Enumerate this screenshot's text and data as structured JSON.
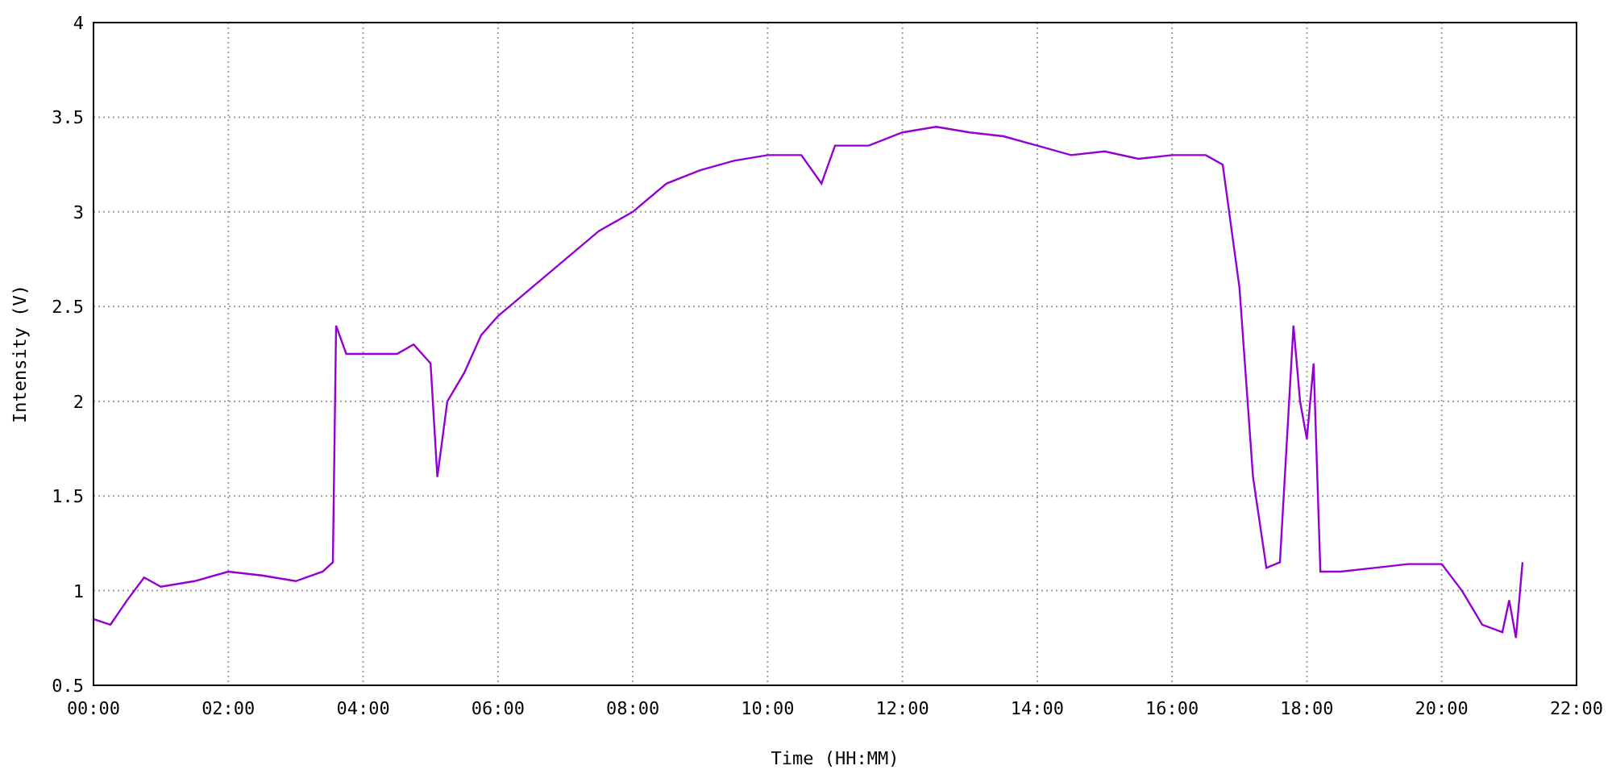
{
  "chart_data": {
    "type": "line",
    "grid": true,
    "xlabel": "Time (HH:MM)",
    "ylabel": "Intensity (V)",
    "x": [
      0,
      0.25,
      0.5,
      0.75,
      1.0,
      1.5,
      2.0,
      2.5,
      3.0,
      3.4,
      3.55,
      3.6,
      3.75,
      4.0,
      4.5,
      4.75,
      5.0,
      5.1,
      5.25,
      5.5,
      5.75,
      6.0,
      6.5,
      7.0,
      7.5,
      8.0,
      8.5,
      9.0,
      9.5,
      10.0,
      10.5,
      10.8,
      11.0,
      11.5,
      12.0,
      12.5,
      13.0,
      13.5,
      14.0,
      14.5,
      15.0,
      15.5,
      16.0,
      16.5,
      16.75,
      17.0,
      17.2,
      17.4,
      17.6,
      17.8,
      17.9,
      18.0,
      18.1,
      18.2,
      18.5,
      19.0,
      19.5,
      20.0,
      20.3,
      20.6,
      20.9,
      21.0,
      21.1,
      21.2
    ],
    "series": [
      {
        "color": "#9400d3",
        "values": [
          0.85,
          0.82,
          0.95,
          1.07,
          1.02,
          1.05,
          1.1,
          1.08,
          1.05,
          1.1,
          1.15,
          2.4,
          2.25,
          2.25,
          2.25,
          2.3,
          2.2,
          1.6,
          2.0,
          2.15,
          2.35,
          2.45,
          2.6,
          2.75,
          2.9,
          3.0,
          3.15,
          3.22,
          3.27,
          3.3,
          3.3,
          3.15,
          3.35,
          3.35,
          3.42,
          3.45,
          3.42,
          3.4,
          3.35,
          3.3,
          3.32,
          3.28,
          3.3,
          3.3,
          3.25,
          2.6,
          1.6,
          1.12,
          1.15,
          2.4,
          2.0,
          1.8,
          2.2,
          1.1,
          1.1,
          1.12,
          1.14,
          1.14,
          1.0,
          0.82,
          0.78,
          0.95,
          0.75,
          1.15
        ]
      }
    ],
    "xlim": [
      0,
      22
    ],
    "ylim": [
      0.5,
      4
    ],
    "xticks": [
      {
        "value": 0,
        "label": "00:00"
      },
      {
        "value": 2,
        "label": "02:00"
      },
      {
        "value": 4,
        "label": "04:00"
      },
      {
        "value": 6,
        "label": "06:00"
      },
      {
        "value": 8,
        "label": "08:00"
      },
      {
        "value": 10,
        "label": "10:00"
      },
      {
        "value": 12,
        "label": "12:00"
      },
      {
        "value": 14,
        "label": "14:00"
      },
      {
        "value": 16,
        "label": "16:00"
      },
      {
        "value": 18,
        "label": "18:00"
      },
      {
        "value": 20,
        "label": "20:00"
      },
      {
        "value": 22,
        "label": "22:00"
      }
    ],
    "yticks": [
      {
        "value": 0.5,
        "label": "0.5"
      },
      {
        "value": 1,
        "label": "1"
      },
      {
        "value": 1.5,
        "label": "1.5"
      },
      {
        "value": 2,
        "label": "2"
      },
      {
        "value": 2.5,
        "label": "2.5"
      },
      {
        "value": 3,
        "label": "3"
      },
      {
        "value": 3.5,
        "label": "3.5"
      },
      {
        "value": 4,
        "label": "4"
      }
    ]
  }
}
